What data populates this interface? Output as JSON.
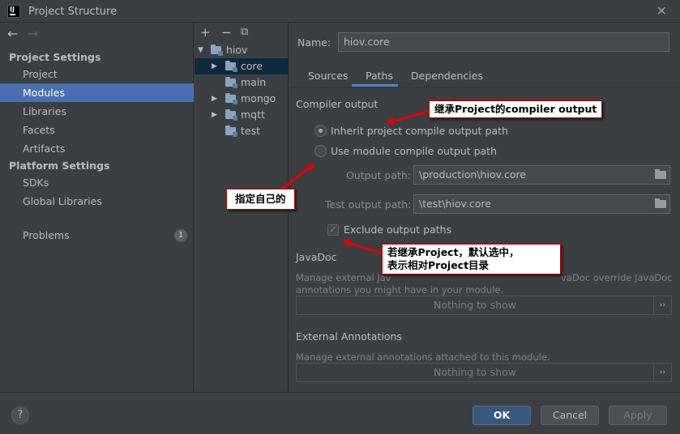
{
  "window": {
    "title": "Project Structure",
    "close": "✕",
    "logo": "IJ"
  },
  "nav": {
    "back": "←",
    "forward": "→"
  },
  "sidebar": {
    "project_settings_title": "Project Settings",
    "items": [
      {
        "label": "Project"
      },
      {
        "label": "Modules",
        "selected": true
      },
      {
        "label": "Libraries"
      },
      {
        "label": "Facets"
      },
      {
        "label": "Artifacts"
      }
    ],
    "platform_settings_title": "Platform Settings",
    "platform_items": [
      {
        "label": "SDKs"
      },
      {
        "label": "Global Libraries"
      }
    ],
    "problems": {
      "label": "Problems",
      "count": "1"
    }
  },
  "tree": {
    "toolbar": {
      "add": "+",
      "remove": "−",
      "copy": "⧉"
    },
    "root": "hiov",
    "children": [
      "core",
      "main",
      "mongo",
      "mqtt",
      "test"
    ]
  },
  "module": {
    "name_label": "Name:",
    "name_value": "hiov.core",
    "tabs": [
      "Sources",
      "Paths",
      "Dependencies"
    ],
    "compiler_output_title": "Compiler output",
    "inherit_option": "Inherit project compile output path",
    "module_option": "Use module compile output path",
    "output_path_label": "Output path:",
    "output_path_value": "\\production\\hiov.core",
    "test_output_path_label": "Test output path:",
    "test_output_path_value": "\\test\\hiov.core",
    "exclude_label": "Exclude output paths",
    "javadoc_title": "JavaDoc",
    "javadoc_desc_1": "Manage external Jav",
    "javadoc_desc_1b": "vaDoc override JavaDoc",
    "javadoc_desc_2": "annotations you might have in your module.",
    "nothing_to_show": "Nothing to show",
    "more": "››",
    "external_annotations_title": "External Annotations",
    "external_annotations_desc": "Manage external annotations attached to this module."
  },
  "buttons": {
    "help": "?",
    "ok": "OK",
    "cancel": "Cancel",
    "apply": "Apply"
  },
  "annotations": {
    "inherit_note": "继承Project的compiler output",
    "own_note": "指定自己的",
    "exclude_note_1": "若继承Project，默认选中，",
    "exclude_note_2": "表示相对Project目录"
  },
  "colors": {
    "selection": "#4b6eaf",
    "tree_selection": "#0d293e",
    "primary_button": "#365880",
    "annotation_border": "#c00000",
    "arrow": "#e00000"
  }
}
